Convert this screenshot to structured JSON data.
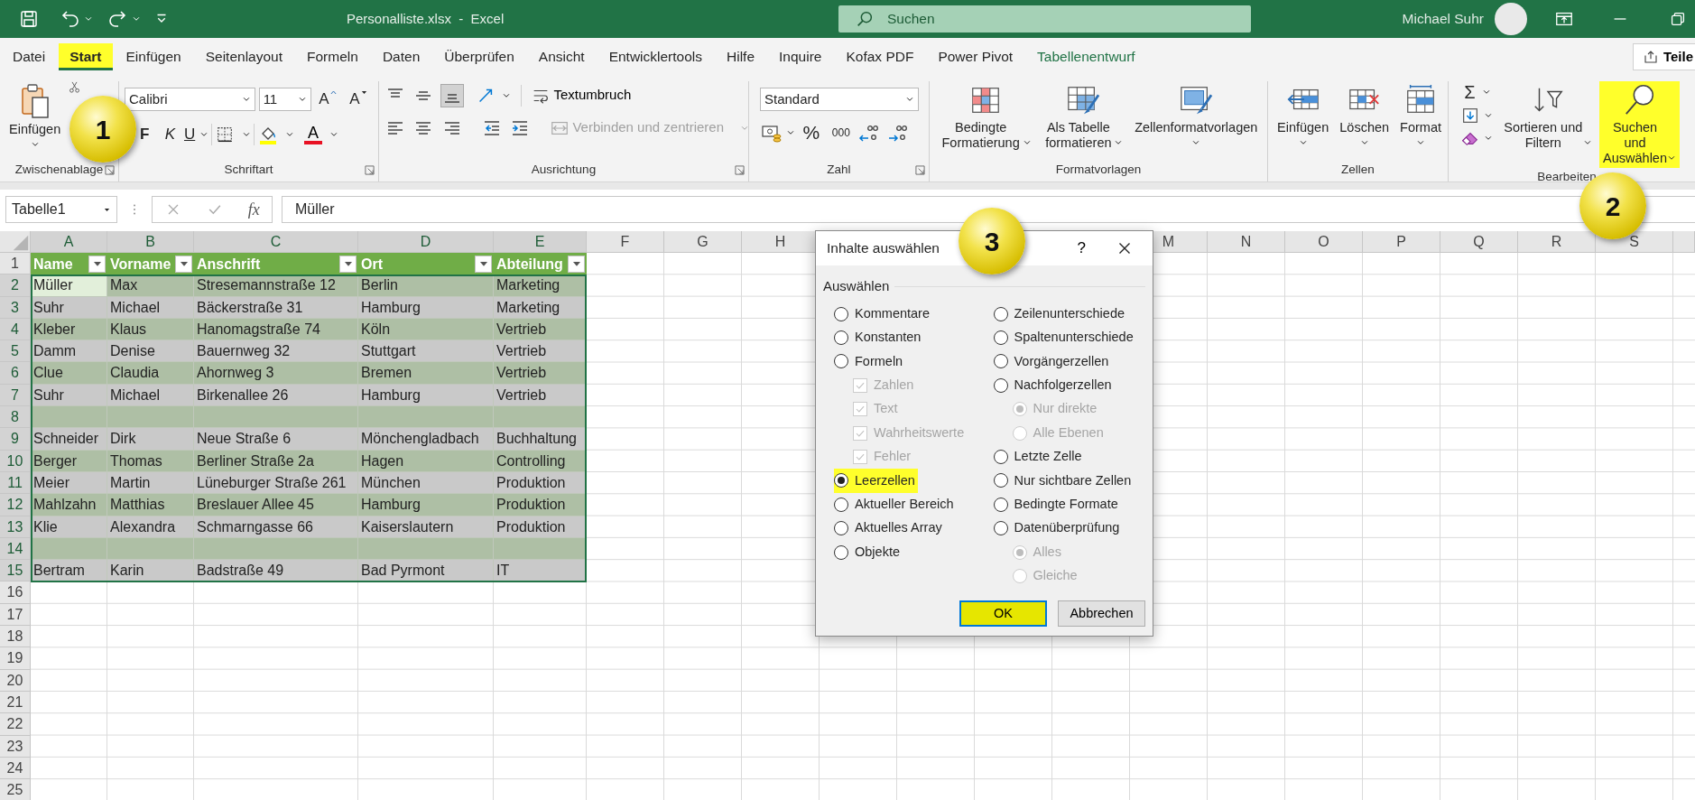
{
  "title_bar": {
    "file_title": "Personalliste.xlsx  -  Excel",
    "search_placeholder": "Suchen",
    "user_name": "Michael Suhr"
  },
  "ribbon_tabs": [
    {
      "label": "Datei",
      "selected": false,
      "highlighted": false,
      "contextual": false
    },
    {
      "label": "Start",
      "selected": true,
      "highlighted": true,
      "contextual": false
    },
    {
      "label": "Einfügen",
      "selected": false,
      "highlighted": false,
      "contextual": false
    },
    {
      "label": "Seitenlayout",
      "selected": false,
      "highlighted": false,
      "contextual": false
    },
    {
      "label": "Formeln",
      "selected": false,
      "highlighted": false,
      "contextual": false
    },
    {
      "label": "Daten",
      "selected": false,
      "highlighted": false,
      "contextual": false
    },
    {
      "label": "Überprüfen",
      "selected": false,
      "highlighted": false,
      "contextual": false
    },
    {
      "label": "Ansicht",
      "selected": false,
      "highlighted": false,
      "contextual": false
    },
    {
      "label": "Entwicklertools",
      "selected": false,
      "highlighted": false,
      "contextual": false
    },
    {
      "label": "Hilfe",
      "selected": false,
      "highlighted": false,
      "contextual": false
    },
    {
      "label": "Inquire",
      "selected": false,
      "highlighted": false,
      "contextual": false
    },
    {
      "label": "Kofax PDF",
      "selected": false,
      "highlighted": false,
      "contextual": false
    },
    {
      "label": "Power Pivot",
      "selected": false,
      "highlighted": false,
      "contextual": false
    },
    {
      "label": "Tabellenentwurf",
      "selected": false,
      "highlighted": false,
      "contextual": true
    }
  ],
  "share_button": "Teile",
  "ribbon": {
    "clipboard": {
      "paste": "Einfügen",
      "group": "Zwischenablage"
    },
    "font": {
      "name": "Calibri",
      "size": "11",
      "grow": "A",
      "shrink": "A",
      "bold": "F",
      "italic": "K",
      "underline": "U",
      "font_color": "A",
      "group": "Schriftart"
    },
    "alignment": {
      "vertical_buttons": [
        {
          "selected": false
        },
        {
          "selected": false
        },
        {
          "selected": true
        }
      ],
      "wrap": "Textumbruch",
      "merge": "Verbinden und zentrieren",
      "merge_disabled": true,
      "group": "Ausrichtung"
    },
    "number": {
      "format": "Standard",
      "percent": "%",
      "thousands": "000",
      "group": "Zahl"
    },
    "styles": {
      "conditional": "Bedingte Formatierung",
      "as_table": "Als Tabelle formatieren",
      "cell_styles": "Zellenformatvorlagen",
      "group": "Formatvorlagen"
    },
    "cells": {
      "insert": "Einfügen",
      "delete": "Löschen",
      "format": "Format",
      "group": "Zellen"
    },
    "editing": {
      "autosum": "Σ",
      "sort": "Sortieren und Filtern",
      "find": "Suchen und Auswählen",
      "find_highlighted": true,
      "group": "Bearbeiten"
    }
  },
  "formula_bar": {
    "name_box": "Tabelle1",
    "function_label": "fx",
    "value": "Müller"
  },
  "sheet": {
    "columns_left": [
      "A",
      "B",
      "C",
      "D",
      "E",
      "F",
      "G",
      "H"
    ],
    "columns_right": [
      "M",
      "N",
      "O",
      "P",
      "Q",
      "R",
      "S"
    ],
    "row_numbers": [
      "1",
      "2",
      "3",
      "4",
      "5",
      "6",
      "7",
      "8",
      "9",
      "10",
      "11",
      "12",
      "13",
      "14",
      "15",
      "16",
      "17",
      "18",
      "19",
      "20",
      "21",
      "22",
      "23",
      "24",
      "25"
    ],
    "table": {
      "headers": [
        "Name",
        "Vorname",
        "Anschrift",
        "Ort",
        "Abteilung"
      ],
      "rows": [
        {
          "cells": [
            {
              "text": "Müller",
              "active": true
            },
            {
              "text": "Max",
              "active": false
            },
            {
              "text": "Stresemannstraße 12",
              "active": false
            },
            {
              "text": "Berlin",
              "active": false
            },
            {
              "text": "Marketing",
              "active": false
            }
          ]
        },
        {
          "cells": [
            {
              "text": "Suhr",
              "active": false
            },
            {
              "text": "Michael",
              "active": false
            },
            {
              "text": "Bäckerstraße 31",
              "active": false
            },
            {
              "text": "Hamburg",
              "active": false
            },
            {
              "text": "Marketing",
              "active": false
            }
          ]
        },
        {
          "cells": [
            {
              "text": "Kleber",
              "active": false
            },
            {
              "text": "Klaus",
              "active": false
            },
            {
              "text": "Hanomagstraße 74",
              "active": false
            },
            {
              "text": "Köln",
              "active": false
            },
            {
              "text": "Vertrieb",
              "active": false
            }
          ]
        },
        {
          "cells": [
            {
              "text": "Damm",
              "active": false
            },
            {
              "text": "Denise",
              "active": false
            },
            {
              "text": "Bauernweg 32",
              "active": false
            },
            {
              "text": "Stuttgart",
              "active": false
            },
            {
              "text": "Vertrieb",
              "active": false
            }
          ]
        },
        {
          "cells": [
            {
              "text": "Clue",
              "active": false
            },
            {
              "text": "Claudia",
              "active": false
            },
            {
              "text": "Ahornweg 3",
              "active": false
            },
            {
              "text": "Bremen",
              "active": false
            },
            {
              "text": "Vertrieb",
              "active": false
            }
          ]
        },
        {
          "cells": [
            {
              "text": "Suhr",
              "active": false
            },
            {
              "text": "Michael",
              "active": false
            },
            {
              "text": "Birkenallee 26",
              "active": false
            },
            {
              "text": "Hamburg",
              "active": false
            },
            {
              "text": "Vertrieb",
              "active": false
            }
          ]
        },
        {
          "blank": true
        },
        {
          "cells": [
            {
              "text": "Schneider",
              "active": false
            },
            {
              "text": "Dirk",
              "active": false
            },
            {
              "text": "Neue Straße 6",
              "active": false
            },
            {
              "text": "Mönchengladbach",
              "active": false
            },
            {
              "text": "Buchhaltung",
              "active": false
            }
          ]
        },
        {
          "cells": [
            {
              "text": "Berger",
              "active": false
            },
            {
              "text": "Thomas",
              "active": false
            },
            {
              "text": "Berliner Straße 2a",
              "active": false
            },
            {
              "text": "Hagen",
              "active": false
            },
            {
              "text": "Controlling",
              "active": false
            }
          ]
        },
        {
          "cells": [
            {
              "text": "Meier",
              "active": false
            },
            {
              "text": "Martin",
              "active": false
            },
            {
              "text": "Lüneburger Straße 261",
              "active": false
            },
            {
              "text": "München",
              "active": false
            },
            {
              "text": "Produktion",
              "active": false
            }
          ]
        },
        {
          "cells": [
            {
              "text": "Mahlzahn",
              "active": false
            },
            {
              "text": "Matthias",
              "active": false
            },
            {
              "text": "Breslauer Allee 45",
              "active": false
            },
            {
              "text": "Hamburg",
              "active": false
            },
            {
              "text": "Produktion",
              "active": false
            }
          ]
        },
        {
          "cells": [
            {
              "text": "Klie",
              "active": false
            },
            {
              "text": "Alexandra",
              "active": false
            },
            {
              "text": "Schmarngasse 66",
              "active": false
            },
            {
              "text": "Kaiserslautern",
              "active": false
            },
            {
              "text": "Produktion",
              "active": false
            }
          ]
        },
        {
          "blank": true
        },
        {
          "cells": [
            {
              "text": "Bertram",
              "active": false
            },
            {
              "text": "Karin",
              "active": false
            },
            {
              "text": "Badstraße 49",
              "active": false
            },
            {
              "text": "Bad Pyrmont",
              "active": false
            },
            {
              "text": "IT",
              "active": false
            }
          ]
        }
      ]
    }
  },
  "dialog": {
    "title": "Inhalte auswählen",
    "help": "?",
    "group_label": "Auswählen",
    "left_options": [
      {
        "label": "Kommentare",
        "kind": "radio",
        "selected": false,
        "disabled": false,
        "highlighted": false
      },
      {
        "label": "Konstanten",
        "kind": "radio",
        "selected": false,
        "disabled": false,
        "highlighted": false
      },
      {
        "label": "Formeln",
        "kind": "radio",
        "selected": false,
        "disabled": false,
        "highlighted": false,
        "children": [
          {
            "label": "Zahlen",
            "kind": "check",
            "checked": true,
            "disabled": true,
            "highlighted": false
          },
          {
            "label": "Text",
            "kind": "check",
            "checked": true,
            "disabled": true,
            "highlighted": false
          },
          {
            "label": "Wahrheitswerte",
            "kind": "check",
            "checked": true,
            "disabled": true,
            "highlighted": false
          },
          {
            "label": "Fehler",
            "kind": "check",
            "checked": true,
            "disabled": true,
            "highlighted": false
          }
        ]
      },
      {
        "label": "Leerzellen",
        "kind": "radio",
        "selected": true,
        "disabled": false,
        "highlighted": true
      },
      {
        "label": "Aktueller Bereich",
        "kind": "radio",
        "selected": false,
        "disabled": false,
        "highlighted": false
      },
      {
        "label": "Aktuelles Array",
        "kind": "radio",
        "selected": false,
        "disabled": false,
        "highlighted": false
      },
      {
        "label": "Objekte",
        "kind": "radio",
        "selected": false,
        "disabled": false,
        "highlighted": false
      }
    ],
    "right_options": [
      {
        "label": "Zeilenunterschiede",
        "kind": "radio",
        "selected": false,
        "disabled": false,
        "highlighted": false
      },
      {
        "label": "Spaltenunterschiede",
        "kind": "radio",
        "selected": false,
        "disabled": false,
        "highlighted": false
      },
      {
        "label": "Vorgängerzellen",
        "kind": "radio",
        "selected": false,
        "disabled": false,
        "highlighted": false
      },
      {
        "label": "Nachfolgerzellen",
        "kind": "radio",
        "selected": false,
        "disabled": false,
        "highlighted": false,
        "children": [
          {
            "label": "Nur direkte",
            "kind": "radio",
            "selected": true,
            "disabled": true,
            "highlighted": false
          },
          {
            "label": "Alle Ebenen",
            "kind": "radio",
            "selected": false,
            "disabled": true,
            "highlighted": false
          }
        ]
      },
      {
        "label": "Letzte Zelle",
        "kind": "radio",
        "selected": false,
        "disabled": false,
        "highlighted": false
      },
      {
        "label": "Nur sichtbare Zellen",
        "kind": "radio",
        "selected": false,
        "disabled": false,
        "highlighted": false
      },
      {
        "label": "Bedingte Formate",
        "kind": "radio",
        "selected": false,
        "disabled": false,
        "highlighted": false
      },
      {
        "label": "Datenüberprüfung",
        "kind": "radio",
        "selected": false,
        "disabled": false,
        "highlighted": false,
        "children": [
          {
            "label": "Alles",
            "kind": "radio",
            "selected": true,
            "disabled": true,
            "highlighted": false
          },
          {
            "label": "Gleiche",
            "kind": "radio",
            "selected": false,
            "disabled": true,
            "highlighted": false
          }
        ]
      }
    ],
    "buttons": [
      {
        "label": "OK",
        "default": true,
        "highlighted": true
      },
      {
        "label": "Abbrechen",
        "default": false,
        "highlighted": false
      }
    ]
  },
  "callouts": [
    {
      "label": "1"
    },
    {
      "label": "2"
    },
    {
      "label": "3"
    }
  ]
}
